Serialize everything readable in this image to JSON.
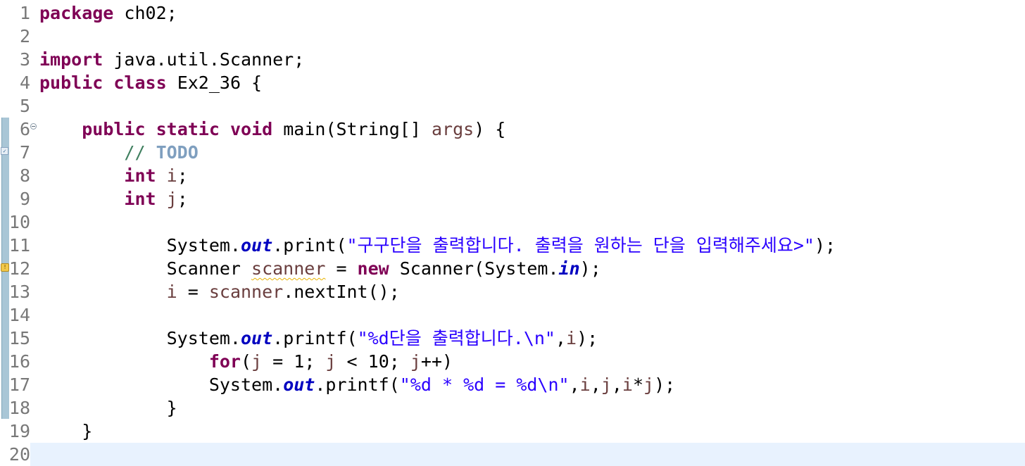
{
  "editor": {
    "colors": {
      "keyword": "#7f0055",
      "string": "#2a00ff",
      "field": "#0000c0",
      "local_var": "#6a3e3e",
      "comment": "#3f7f5f",
      "todo": "#7f9fbf",
      "line_number": "#787878",
      "current_line": "#e8f2fe"
    },
    "lines": [
      {
        "n": "1",
        "parts": [
          {
            "c": "kw",
            "t": "package"
          },
          {
            "c": "",
            "t": " ch02;"
          }
        ]
      },
      {
        "n": "2",
        "parts": []
      },
      {
        "n": "3",
        "parts": [
          {
            "c": "kw",
            "t": "import"
          },
          {
            "c": "",
            "t": " java.util.Scanner;"
          }
        ]
      },
      {
        "n": "4",
        "parts": [
          {
            "c": "kw",
            "t": "public"
          },
          {
            "c": "",
            "t": " "
          },
          {
            "c": "kw",
            "t": "class"
          },
          {
            "c": "",
            "t": " Ex2_36 {"
          }
        ]
      },
      {
        "n": "5",
        "parts": []
      },
      {
        "n": "6",
        "parts": [
          {
            "c": "",
            "t": "    "
          },
          {
            "c": "kw",
            "t": "public"
          },
          {
            "c": "",
            "t": " "
          },
          {
            "c": "kw",
            "t": "static"
          },
          {
            "c": "",
            "t": " "
          },
          {
            "c": "kw",
            "t": "void"
          },
          {
            "c": "",
            "t": " main(String[] "
          },
          {
            "c": "var",
            "t": "args"
          },
          {
            "c": "",
            "t": ") {"
          }
        ]
      },
      {
        "n": "7",
        "parts": [
          {
            "c": "",
            "t": "        "
          },
          {
            "c": "cmt",
            "t": "// "
          },
          {
            "c": "todo",
            "t": "TODO"
          }
        ]
      },
      {
        "n": "8",
        "parts": [
          {
            "c": "",
            "t": "        "
          },
          {
            "c": "kw",
            "t": "int"
          },
          {
            "c": "",
            "t": " "
          },
          {
            "c": "var",
            "t": "i"
          },
          {
            "c": "",
            "t": ";"
          }
        ]
      },
      {
        "n": "9",
        "parts": [
          {
            "c": "",
            "t": "        "
          },
          {
            "c": "kw",
            "t": "int"
          },
          {
            "c": "",
            "t": " "
          },
          {
            "c": "var",
            "t": "j"
          },
          {
            "c": "",
            "t": ";"
          }
        ]
      },
      {
        "n": "10",
        "parts": []
      },
      {
        "n": "11",
        "parts": [
          {
            "c": "",
            "t": "            System."
          },
          {
            "c": "field",
            "t": "out"
          },
          {
            "c": "",
            "t": ".print("
          },
          {
            "c": "str",
            "t": "\"구구단을 출력합니다. 출력을 원하는 단을 입력해주세요>\""
          },
          {
            "c": "",
            "t": ");"
          }
        ]
      },
      {
        "n": "12",
        "parts": [
          {
            "c": "",
            "t": "            Scanner "
          },
          {
            "c": "var squiggle",
            "t": "scanner"
          },
          {
            "c": "",
            "t": " = "
          },
          {
            "c": "kw",
            "t": "new"
          },
          {
            "c": "",
            "t": " Scanner(System."
          },
          {
            "c": "field",
            "t": "in"
          },
          {
            "c": "",
            "t": ");"
          }
        ]
      },
      {
        "n": "13",
        "parts": [
          {
            "c": "",
            "t": "            "
          },
          {
            "c": "var",
            "t": "i"
          },
          {
            "c": "",
            "t": " = "
          },
          {
            "c": "var",
            "t": "scanner"
          },
          {
            "c": "",
            "t": ".nextInt();"
          }
        ]
      },
      {
        "n": "14",
        "parts": []
      },
      {
        "n": "15",
        "parts": [
          {
            "c": "",
            "t": "            System."
          },
          {
            "c": "field",
            "t": "out"
          },
          {
            "c": "",
            "t": ".printf("
          },
          {
            "c": "str",
            "t": "\"%d단을 출력합니다.\\n\""
          },
          {
            "c": "",
            "t": ","
          },
          {
            "c": "var",
            "t": "i"
          },
          {
            "c": "",
            "t": ");"
          }
        ]
      },
      {
        "n": "16",
        "parts": [
          {
            "c": "",
            "t": "                "
          },
          {
            "c": "kw",
            "t": "for"
          },
          {
            "c": "",
            "t": "("
          },
          {
            "c": "var",
            "t": "j"
          },
          {
            "c": "",
            "t": " = 1; "
          },
          {
            "c": "var",
            "t": "j"
          },
          {
            "c": "",
            "t": " < 10; "
          },
          {
            "c": "var",
            "t": "j"
          },
          {
            "c": "",
            "t": "++)"
          }
        ]
      },
      {
        "n": "17",
        "parts": [
          {
            "c": "",
            "t": "                System."
          },
          {
            "c": "field",
            "t": "out"
          },
          {
            "c": "",
            "t": ".printf("
          },
          {
            "c": "str",
            "t": "\"%d * %d = %d\\n\""
          },
          {
            "c": "",
            "t": ","
          },
          {
            "c": "var",
            "t": "i"
          },
          {
            "c": "",
            "t": ","
          },
          {
            "c": "var",
            "t": "j"
          },
          {
            "c": "",
            "t": ","
          },
          {
            "c": "var",
            "t": "i"
          },
          {
            "c": "",
            "t": "*"
          },
          {
            "c": "var",
            "t": "j"
          },
          {
            "c": "",
            "t": ");"
          }
        ]
      },
      {
        "n": "18",
        "parts": [
          {
            "c": "",
            "t": "            }"
          }
        ]
      },
      {
        "n": "19",
        "parts": [
          {
            "c": "",
            "t": "    }"
          }
        ]
      },
      {
        "n": "20",
        "parts": [],
        "current": true
      }
    ]
  },
  "gutter": {
    "fold_icon": "collapse-icon",
    "task_marker": "task-marker-icon",
    "warning_marker": "warning-icon"
  }
}
